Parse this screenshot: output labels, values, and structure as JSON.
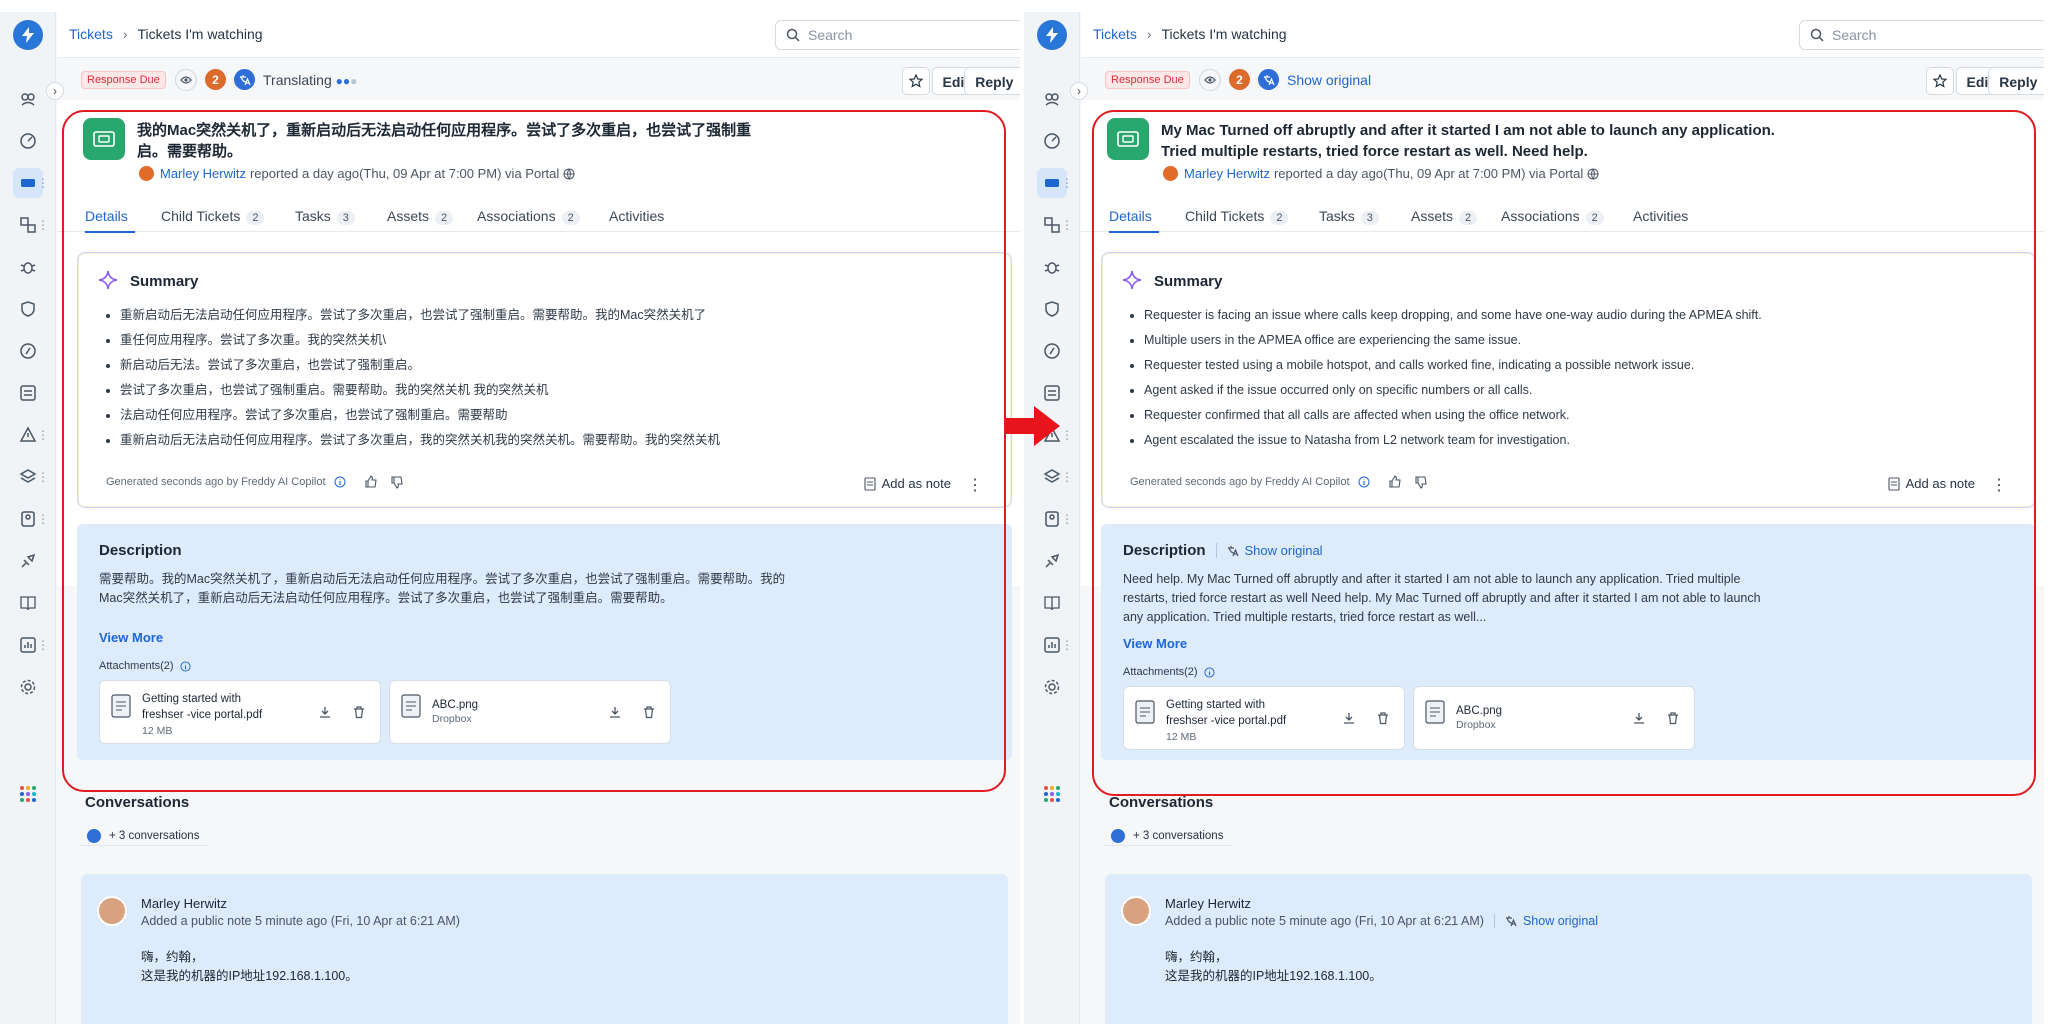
{
  "before": {
    "breadcrumb": {
      "root": "Tickets",
      "current": "Tickets I'm watching"
    },
    "search": {
      "placeholder": "Search"
    },
    "header": {
      "badge": "Response Due",
      "watcher_count": "2",
      "translate_status": "Translating",
      "edit": "Edit",
      "reply": "Reply"
    },
    "ticket": {
      "subject": "我的Mac突然关机了，重新启动后无法启动任何应用程序。尝试了多次重启，也尝试了强制重启。需要帮助。",
      "reporter": "Marley Herwitz",
      "reported_meta": "reported a day ago(Thu, 09 Apr at 7:00 PM) via Portal"
    },
    "tabs": [
      {
        "label": "Details",
        "count": ""
      },
      {
        "label": "Child Tickets",
        "count": "2"
      },
      {
        "label": "Tasks",
        "count": "3"
      },
      {
        "label": "Assets",
        "count": "2"
      },
      {
        "label": "Associations",
        "count": "2"
      },
      {
        "label": "Activities",
        "count": ""
      }
    ],
    "summary": {
      "title": "Summary",
      "items": [
        "重新启动后无法启动任何应用程序。尝试了多次重启，也尝试了强制重启。需要帮助。我的Mac突然关机了",
        "重任何应用程序。尝试了多次重。我的突然关机\\",
        "新启动后无法。尝试了多次重启，也尝试了强制重启。",
        "尝试了多次重启，也尝试了强制重启。需要帮助。我的突然关机 我的突然关机",
        "法启动任何应用程序。尝试了多次重启，也尝试了强制重启。需要帮助",
        "重新启动后无法启动任何应用程序。尝试了多次重启，我的突然关机我的突然关机。需要帮助。我的突然关机"
      ],
      "footer": "Generated seconds ago by Freddy AI Copilot",
      "add_note": "Add as note"
    },
    "description": {
      "title": "Description",
      "show_original": "",
      "line1": "需要帮助。我的Mac突然关机了，重新启动后无法启动任何应用程序。尝试了多次重启，也尝试了强制重启。需要帮助。我的",
      "line2": "Mac突然关机了，重新启动后无法启动任何应用程序。尝试了多次重启，也尝试了强制重启。需要帮助。",
      "line3": "",
      "view_more": "View More",
      "attachments_label": "Attachments(2)",
      "attachments": [
        {
          "name": "Getting started with freshser -vice portal.pdf",
          "meta": "12 MB"
        },
        {
          "name": "ABC.png",
          "meta": "Dropbox"
        }
      ]
    },
    "conversations": {
      "title": "Conversations",
      "more": "+ 3 conversations",
      "note": {
        "author": "Marley Herwitz",
        "meta": "Added a public note 5 minute ago (Fri, 10 Apr at 6:21 AM)",
        "show_original": "",
        "body1": "嗨，约翰，",
        "body2": "这是我的机器的IP地址192.168.1.100。"
      }
    }
  },
  "after": {
    "breadcrumb": {
      "root": "Tickets",
      "current": "Tickets I'm watching"
    },
    "search": {
      "placeholder": "Search"
    },
    "header": {
      "badge": "Response Due",
      "watcher_count": "2",
      "translate_status": "Show original",
      "edit": "Edit",
      "reply": "Reply"
    },
    "ticket": {
      "subject": "My Mac Turned off abruptly and after it started I am not able to launch any application. Tried multiple restarts, tried force restart as well. Need help.",
      "reporter": "Marley Herwitz",
      "reported_meta": "reported a day ago(Thu, 09 Apr at 7:00 PM) via Portal"
    },
    "tabs": [
      {
        "label": "Details",
        "count": ""
      },
      {
        "label": "Child Tickets",
        "count": "2"
      },
      {
        "label": "Tasks",
        "count": "3"
      },
      {
        "label": "Assets",
        "count": "2"
      },
      {
        "label": "Associations",
        "count": "2"
      },
      {
        "label": "Activities",
        "count": ""
      }
    ],
    "summary": {
      "title": "Summary",
      "items": [
        "Requester is facing an issue where calls keep dropping, and some have one-way audio during the APMEA shift.",
        "Multiple users in the APMEA office are experiencing the same issue.",
        "Requester tested using a mobile hotspot, and calls worked fine, indicating a possible network issue.",
        "Agent asked if the issue occurred only on specific numbers or all calls.",
        "Requester confirmed that all calls are affected when using the office network.",
        "Agent escalated the issue to Natasha from L2 network team for investigation."
      ],
      "footer": "Generated seconds ago by Freddy AI Copilot",
      "add_note": "Add as note"
    },
    "description": {
      "title": "Description",
      "show_original": "Show original",
      "line1": "Need help. My Mac Turned off abruptly and after it started I am not able to launch any application. Tried multiple",
      "line2": "restarts, tried force restart as well Need help. My Mac Turned off abruptly and after it started I am not able to launch",
      "line3": "any application. Tried multiple restarts, tried force restart as well...",
      "view_more": "View More",
      "attachments_label": "Attachments(2)",
      "attachments": [
        {
          "name": "Getting started with freshser -vice portal.pdf",
          "meta": "12 MB"
        },
        {
          "name": "ABC.png",
          "meta": "Dropbox"
        }
      ]
    },
    "conversations": {
      "title": "Conversations",
      "more": "+ 3 conversations",
      "note": {
        "author": "Marley Herwitz",
        "meta": "Added a public note 5 minute ago (Fri, 10 Apr at 6:21 AM)",
        "show_original": "Show original",
        "body1": "嗨，约翰，",
        "body2": "这是我的机器的IP地址192.168.1.100。"
      }
    }
  },
  "theme": {
    "accent": "#2066d0",
    "highlight_box": "#e01b24",
    "arrow": "#e8141b",
    "ticket_icon": "#28a86e",
    "badge": "#d8313b"
  }
}
